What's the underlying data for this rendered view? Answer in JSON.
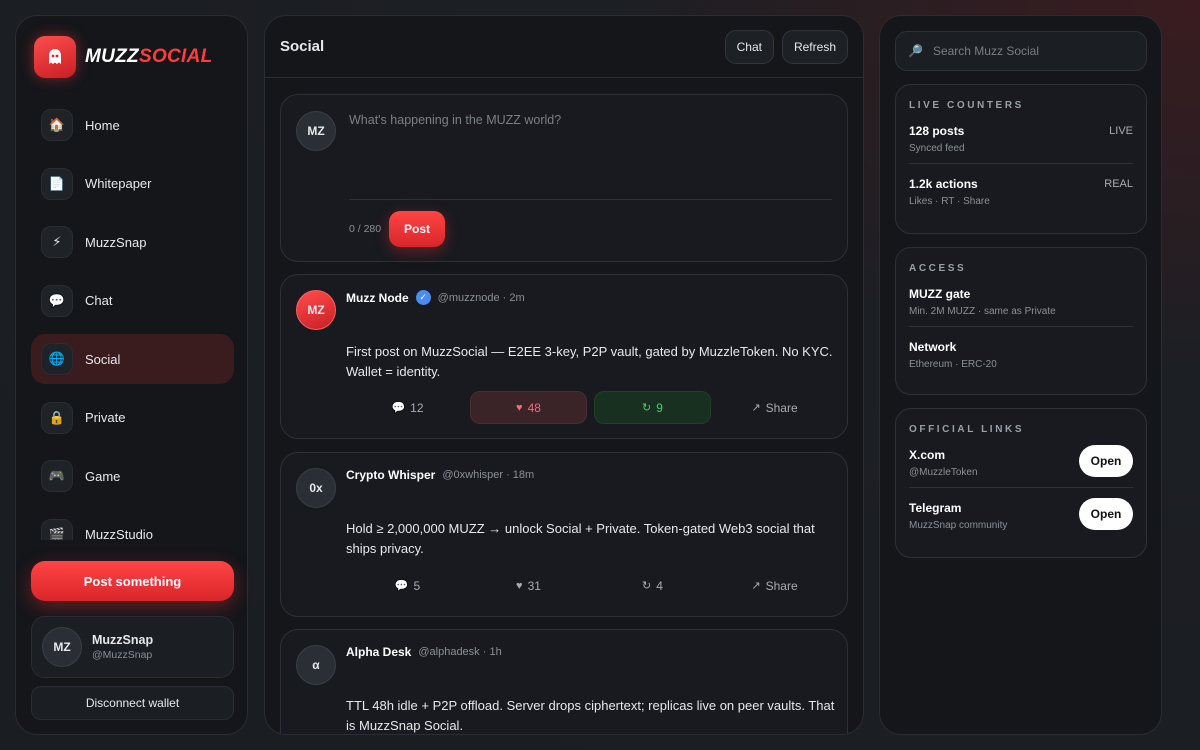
{
  "brand": {
    "name_part1": "MUZZ",
    "name_part2": "SOCIAL",
    "logo_icon": "ghost-icon"
  },
  "nav": [
    {
      "label": "Home",
      "icon": "🏠",
      "active": false
    },
    {
      "label": "Whitepaper",
      "icon": "📄",
      "active": false
    },
    {
      "label": "MuzzSnap",
      "icon": "⚡",
      "active": false
    },
    {
      "label": "Chat",
      "icon": "💬",
      "active": false
    },
    {
      "label": "Social",
      "icon": "🌐",
      "active": true
    },
    {
      "label": "Private",
      "icon": "🔒",
      "active": false
    },
    {
      "label": "Game",
      "icon": "🎮",
      "active": false
    },
    {
      "label": "MuzzStudio",
      "icon": "🎬",
      "active": false
    }
  ],
  "sidebar": {
    "post_button": "Post something",
    "user": {
      "initials": "MZ",
      "name": "MuzzSnap",
      "handle": "@MuzzSnap"
    },
    "disconnect": "Disconnect wallet"
  },
  "main": {
    "title": "Social",
    "chat_button": "Chat",
    "refresh_button": "Refresh",
    "composer": {
      "initials": "MZ",
      "placeholder": "What's happening in the MUZZ world?",
      "counter": "0 / 280",
      "post_button": "Post"
    },
    "posts": [
      {
        "initials": "MZ",
        "author": "Muzz Node",
        "verified": "✓",
        "handle": "@muzznode · 2m",
        "text": "First post on MuzzSocial — E2EE 3-key, P2P vault, gated by MuzzleToken. No KYC. Wallet = identity.",
        "comments": "12",
        "likes": "48",
        "reposts": "9",
        "share": "Share"
      },
      {
        "initials": "0x",
        "author": "Crypto Whisper",
        "handle": "@0xwhisper · 18m",
        "text": "Hold ≥ 2,000,000 MUZZ → unlock Social + Private. Token-gated Web3 social that ships privacy.",
        "comments": "5",
        "likes": "31",
        "reposts": "4",
        "share": "Share"
      },
      {
        "initials": "α",
        "author": "Alpha Desk",
        "handle": "@alphadesk · 1h",
        "text": "TTL 48h idle + P2P offload. Server drops ciphertext; replicas live on peer vaults. That is MuzzSnap Social."
      }
    ]
  },
  "right": {
    "search_placeholder": "Search Muzz Social",
    "counters": {
      "title": "LIVE COUNTERS",
      "rows": [
        {
          "title": "128 posts",
          "sub": "Synced feed",
          "tag": "LIVE"
        },
        {
          "title": "1.2k actions",
          "sub": "Likes · RT · Share",
          "tag": "REAL"
        }
      ]
    },
    "access": {
      "title": "ACCESS",
      "rows": [
        {
          "title": "MUZZ gate",
          "sub": "Min. 2M MUZZ · same as Private"
        },
        {
          "title": "Network",
          "sub": "Ethereum · ERC-20"
        }
      ]
    },
    "links": {
      "title": "OFFICIAL LINKS",
      "rows": [
        {
          "title": "X.com",
          "sub": "@MuzzleToken",
          "button": "Open"
        },
        {
          "title": "Telegram",
          "sub": "MuzzSnap community",
          "button": "Open"
        }
      ]
    }
  },
  "colors": {
    "accent": "#ff3b3b",
    "like": "#f06a84",
    "repost": "#4ecb73",
    "verified": "#4a8cf0"
  }
}
